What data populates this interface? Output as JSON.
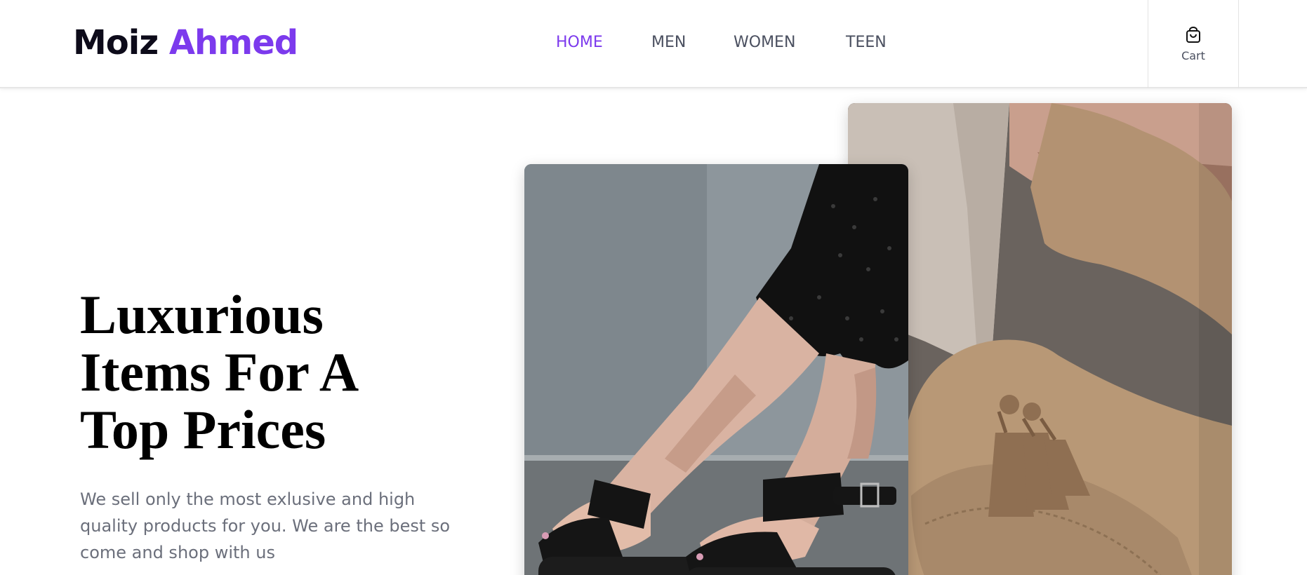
{
  "brand": {
    "first": "Moiz",
    "last": "Ahmed"
  },
  "nav": {
    "items": [
      {
        "label": "HOME",
        "active": true
      },
      {
        "label": "MEN",
        "active": false
      },
      {
        "label": "WOMEN",
        "active": false
      },
      {
        "label": "TEEN",
        "active": false
      }
    ]
  },
  "cart": {
    "label": "Cart",
    "icon": "shopping-bag-icon"
  },
  "hero": {
    "title_lines": [
      "Luxurious",
      "Items For A",
      "Top Prices"
    ],
    "description": "We sell only the most exlusive and high quality products for you. We are the best so come and shop with us"
  },
  "images": {
    "front": "woman-black-sandals-photo",
    "back": "suede-tassel-loafer-photo"
  },
  "colors": {
    "accent": "#7c3aed",
    "logo_dark": "#0d0b1a",
    "nav_text": "#4b5060",
    "body_text": "#6b6f7b"
  }
}
